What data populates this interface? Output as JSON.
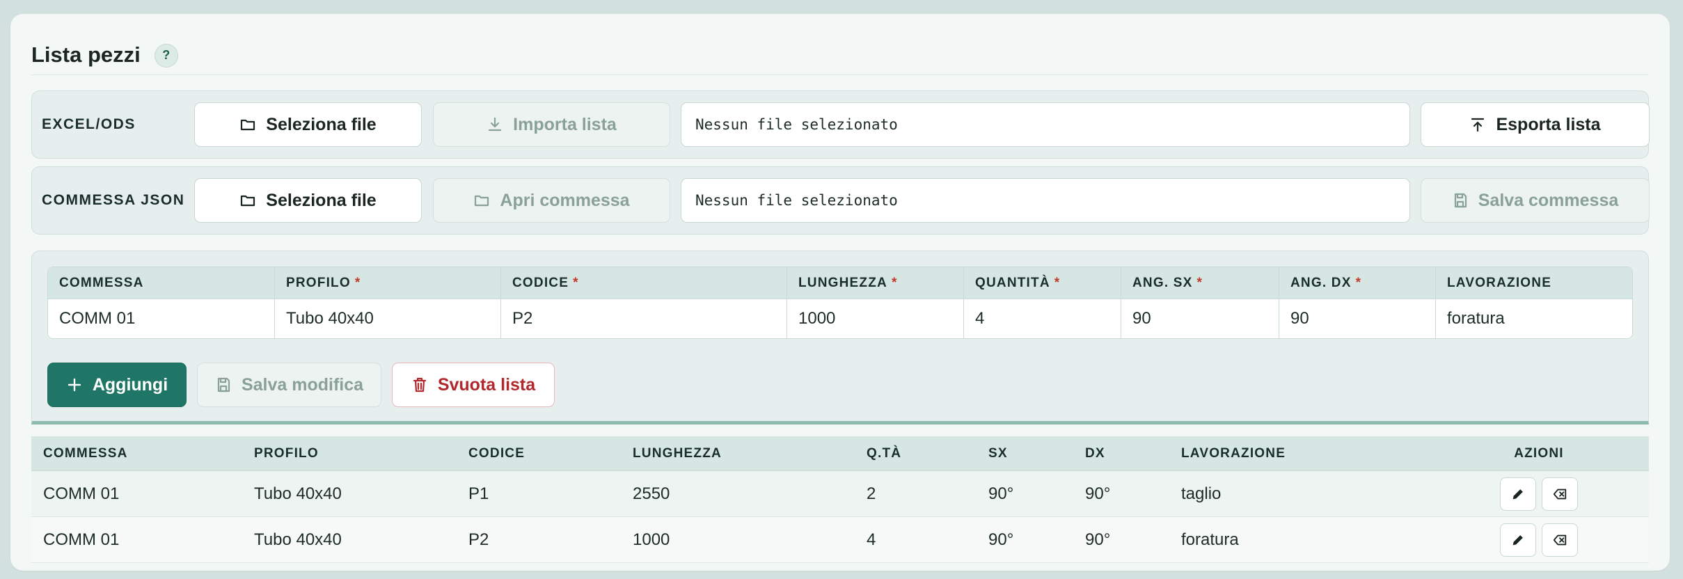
{
  "page": {
    "title": "Lista pezzi",
    "help": "?"
  },
  "excel": {
    "label": "EXCEL/ODS",
    "select_btn": "Seleziona file",
    "import_btn": "Importa lista",
    "file_status": "Nessun file selezionato",
    "export_btn": "Esporta lista"
  },
  "json": {
    "label": "COMMESSA JSON",
    "select_btn": "Seleziona file",
    "open_btn": "Apri commessa",
    "file_status": "Nessun file selezionato",
    "save_btn": "Salva commessa"
  },
  "form": {
    "headers": [
      {
        "label": "COMMESSA",
        "required": ""
      },
      {
        "label": "PROFILO",
        "required": "*"
      },
      {
        "label": "CODICE",
        "required": "*"
      },
      {
        "label": "LUNGHEZZA",
        "required": "*"
      },
      {
        "label": "QUANTITÀ",
        "required": "*"
      },
      {
        "label": "ANG. SX",
        "required": "*"
      },
      {
        "label": "ANG. DX",
        "required": "*"
      },
      {
        "label": "LAVORAZIONE",
        "required": ""
      }
    ],
    "values": [
      "COMM 01",
      "Tubo 40x40",
      "P2",
      "1000",
      "4",
      "90",
      "90",
      "foratura"
    ],
    "add_btn": "Aggiungi",
    "save_edit_btn": "Salva modifica",
    "clear_btn": "Svuota lista"
  },
  "list": {
    "headers": [
      "COMMESSA",
      "PROFILO",
      "CODICE",
      "LUNGHEZZA",
      "Q.TÀ",
      "SX",
      "DX",
      "LAVORAZIONE",
      "AZIONI"
    ],
    "rows": [
      [
        "COMM 01",
        "Tubo 40x40",
        "P1",
        "2550",
        "2",
        "90°",
        "90°",
        "taglio"
      ],
      [
        "COMM 01",
        "Tubo 40x40",
        "P2",
        "1000",
        "4",
        "90°",
        "90°",
        "foratura"
      ]
    ]
  },
  "colors": {
    "accent": "#1f7566",
    "danger": "#b3282d",
    "background": "#d3e1de",
    "card": "#f3f7f6"
  },
  "icons": {
    "select": "folder-icon",
    "import": "download-icon",
    "export": "upload-icon",
    "open": "folder-open-icon",
    "save": "floppy-icon",
    "add": "plus-icon",
    "clear": "trash-icon",
    "edit": "pencil-icon",
    "delete": "backspace-icon"
  }
}
